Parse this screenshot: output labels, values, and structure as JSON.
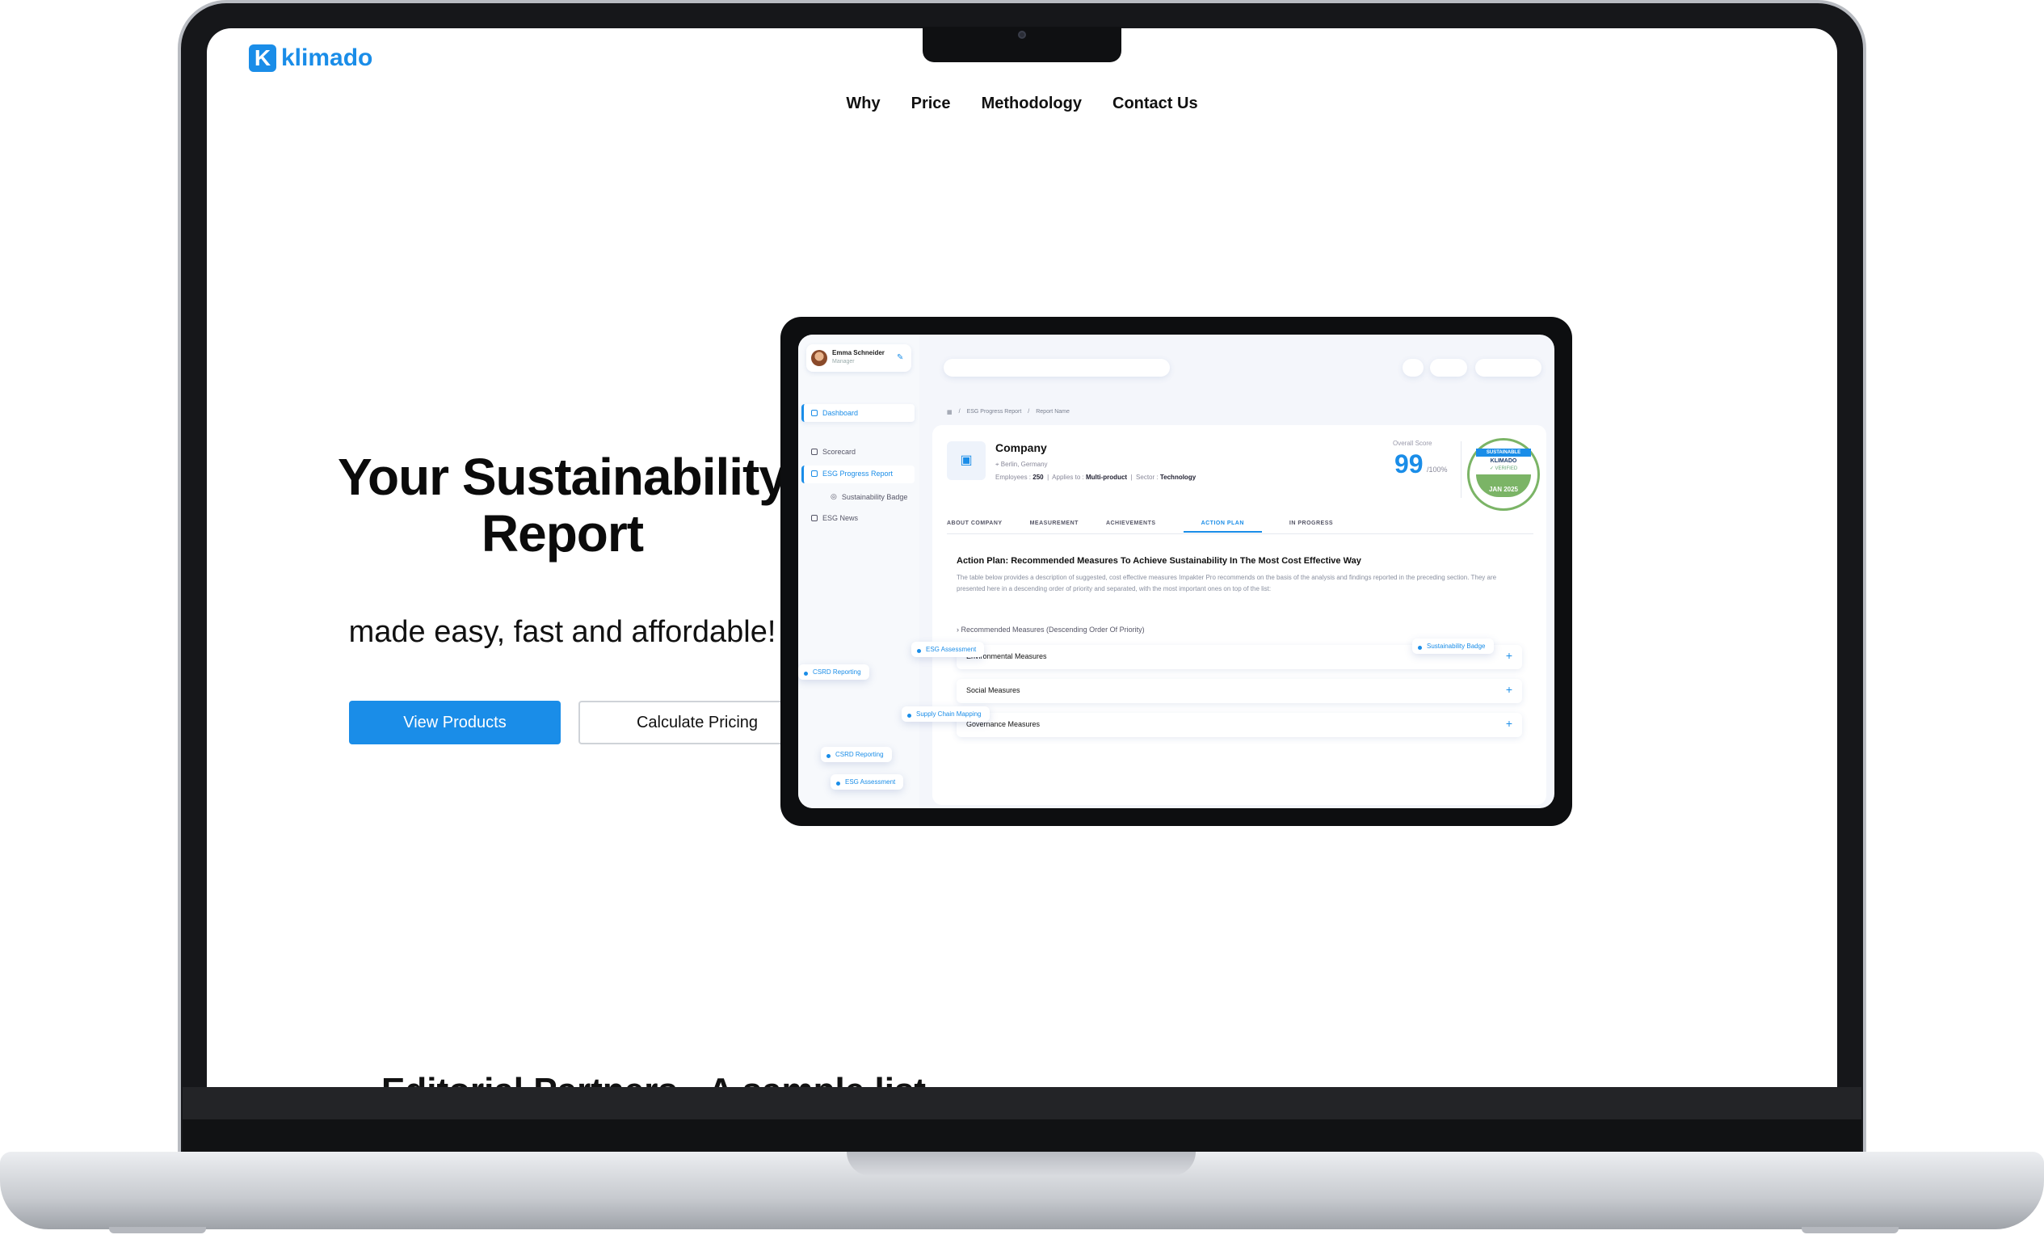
{
  "site": {
    "logo_text": "klimado",
    "logo_glyph": "K",
    "accent_color": "#1a8de8",
    "nav": [
      "Why",
      "Price",
      "Methodology",
      "Contact Us"
    ]
  },
  "hero": {
    "title_line1": "Your Sustainability",
    "title_line2": "Report",
    "subtitle": "made easy, fast and affordable!",
    "primary_button": "View Products",
    "secondary_button": "Calculate Pricing"
  },
  "partners_heading": "Editorial Partners - A sample list",
  "dashboard": {
    "user": {
      "name": "Emma Schneider",
      "role": "Manager"
    },
    "sidebar": {
      "dashboard": "Dashboard",
      "scorecard": "Scorecard",
      "esg_progress": "ESG Progress Report",
      "sustainability_badge": "Sustainability Badge",
      "esg_news": "ESG News"
    },
    "breadcrumb": [
      "ESG Progress Report",
      "Report Name"
    ],
    "company": {
      "name": "Company",
      "location": "Berlin, Germany",
      "employees_label": "Employees :",
      "employees": "250",
      "applies_label": "Applies to :",
      "applies": "Multi-product",
      "sector_label": "Sector :",
      "sector": "Technology"
    },
    "score": {
      "label": "Overall Score",
      "value": "99",
      "denominator": "/100%"
    },
    "badge": {
      "top": "SUSTAINABLE",
      "brand": "KLIMADO",
      "verified": "✓ VERIFIED",
      "date": "JAN 2025"
    },
    "tabs": [
      "ABOUT COMPANY",
      "MEASUREMENT",
      "ACHIEVEMENTS",
      "ACTION PLAN",
      "IN PROGRESS"
    ],
    "action_plan": {
      "title": "Action Plan: Recommended Measures To Achieve Sustainability In The Most Cost Effective Way",
      "description": "The table below provides a description of suggested, cost effective measures Impakter Pro recommends on the basis of the analysis and findings reported in the preceding section. They are presented here in a descending order of priority and separated, with the most important ones on top of the list:",
      "recommended": "Recommended Measures (Descending Order Of Priority)",
      "measures": [
        "Environmental Measures",
        "Social Measures",
        "Governance Measures"
      ]
    },
    "chips": {
      "esg_assessment_1": "ESG Assessment",
      "sustainability_badge": "Sustainability Badge",
      "csrd_reporting_1": "CSRD Reporting",
      "supply_chain": "Supply Chain Mapping",
      "csrd_reporting_2": "CSRD Reporting",
      "esg_assessment_2": "ESG Assessment"
    }
  }
}
